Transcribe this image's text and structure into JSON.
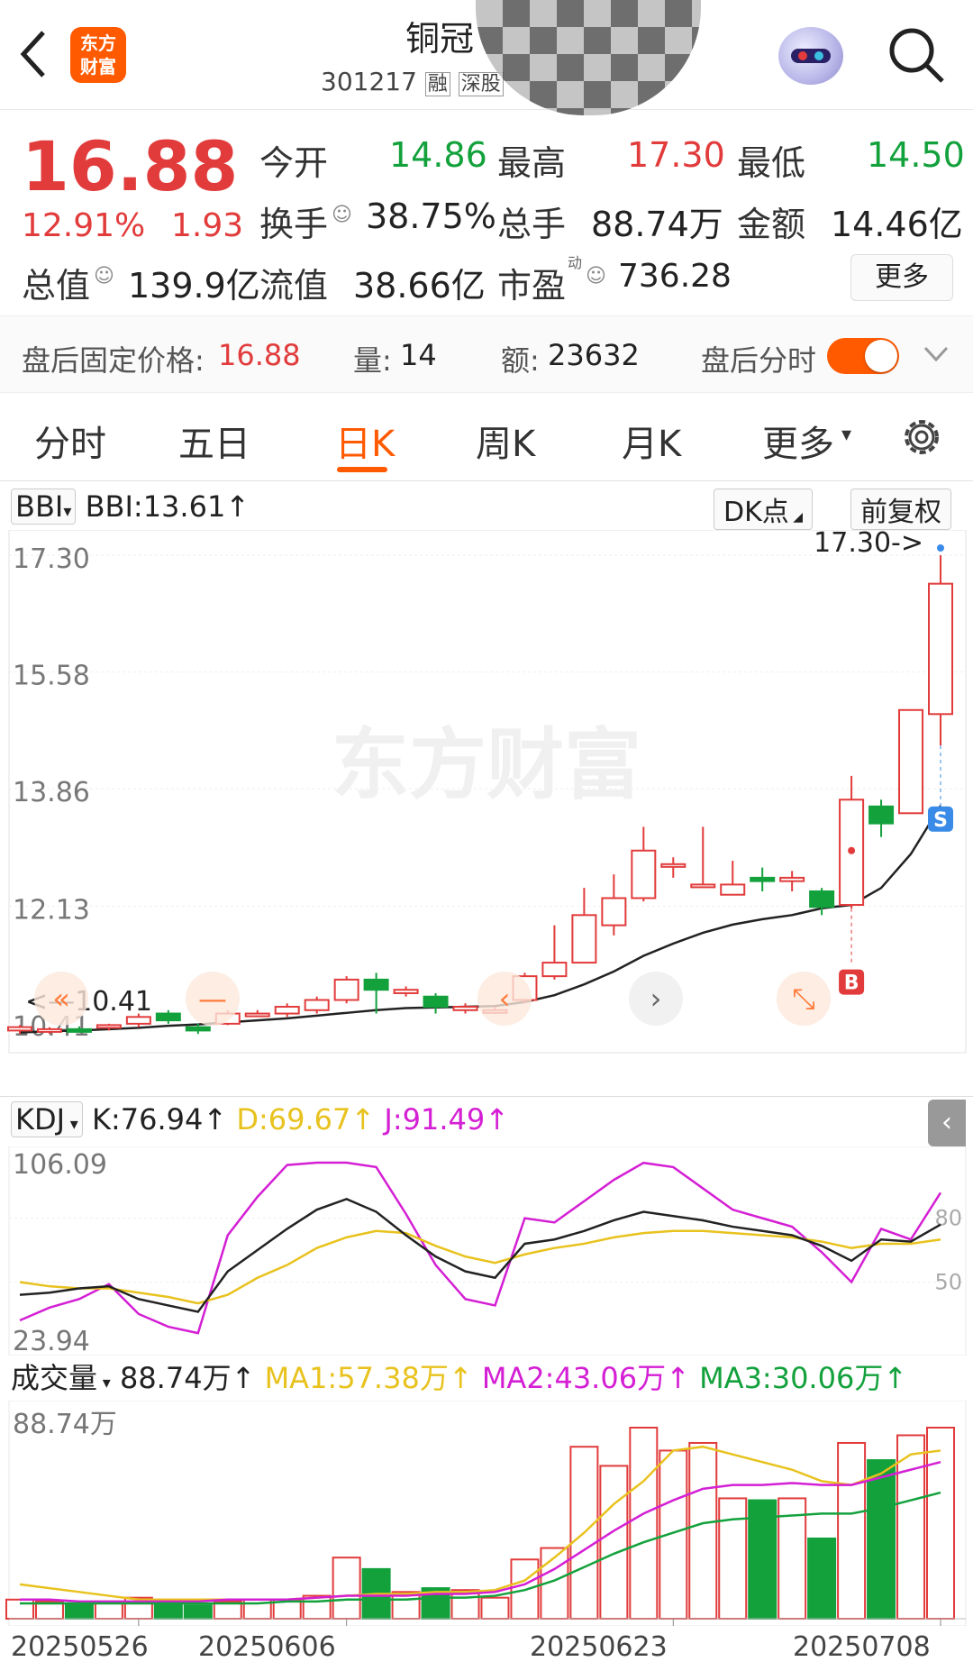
{
  "header": {
    "stock_name": "铜冠",
    "stock_code": "301217",
    "tag_margin": "融",
    "tag_market": "深股",
    "logo_line1": "东方",
    "logo_line2": "财富"
  },
  "quote": {
    "price": "16.88",
    "change_pct": "12.91%",
    "change_amt": "1.93",
    "open_label": "今开",
    "open": "14.86",
    "high_label": "最高",
    "high": "17.30",
    "low_label": "最低",
    "low": "14.50",
    "turnover_label": "换手",
    "turnover": "38.75%",
    "volume_label": "总手",
    "volume": "88.74万",
    "amount_label": "金额",
    "amount": "14.46亿",
    "mktcap_label": "总值",
    "mktcap": "139.9亿",
    "float_label": "流值",
    "float_cap": "38.66亿",
    "pe_label": "市盈",
    "pe_sup": "动",
    "pe": "736.28",
    "more_label": "更多"
  },
  "after_hours": {
    "price_label": "盘后固定价格:",
    "price": "16.88",
    "vol_label": "量:",
    "vol": "14",
    "amt_label": "额:",
    "amt": "23632",
    "toggle_label": "盘后分时",
    "toggle_on": true
  },
  "tabs": [
    "分时",
    "五日",
    "日K",
    "周K",
    "月K",
    "更多"
  ],
  "active_tab": "日K",
  "kline": {
    "indicator": "BBI",
    "bbi_text": "BBI:13.61",
    "dk_label": "DK点",
    "adj_label": "前复权",
    "y_ticks": [
      "17.30",
      "15.58",
      "13.86",
      "12.13"
    ],
    "low_tick": "10.41",
    "high_note": "17.30->",
    "low_note": "<—10.41",
    "watermark": "东方财富",
    "buy_marker": "B",
    "sell_marker": "S"
  },
  "kdj": {
    "label": "KDJ",
    "k": "K:76.94",
    "d": "D:69.67",
    "j": "J:91.49",
    "y_top": "106.09",
    "y_bottom": "23.94",
    "level80": "80",
    "level50": "50"
  },
  "volume_panel": {
    "label": "成交量",
    "vol": "88.74万",
    "ma1": "MA1:57.38万",
    "ma2": "MA2:43.06万",
    "ma3": "MA3:30.06万",
    "y_top": "88.74万"
  },
  "x_dates": [
    "20250526",
    "20250606",
    "20250623",
    "20250708"
  ],
  "colors": {
    "up": "#e23b3b",
    "down": "#13a13c",
    "accent": "#ff5a00",
    "bbi": "#222222",
    "k": "#222222",
    "d": "#e8c21e",
    "j": "#d41fd4",
    "ma1": "#e8c21e",
    "ma2": "#d41fd4",
    "ma3": "#13a13c"
  },
  "chart_data": {
    "type": "candlestick",
    "ylim": [
      10.41,
      17.3
    ],
    "candles": [
      {
        "o": 10.3,
        "c": 10.35,
        "h": 10.38,
        "l": 10.25
      },
      {
        "o": 10.28,
        "c": 10.32,
        "h": 10.35,
        "l": 10.25
      },
      {
        "o": 10.32,
        "c": 10.3,
        "h": 10.36,
        "l": 10.28
      },
      {
        "o": 10.35,
        "c": 10.38,
        "h": 10.4,
        "l": 10.3
      },
      {
        "o": 10.4,
        "c": 10.5,
        "h": 10.55,
        "l": 10.35
      },
      {
        "o": 10.55,
        "c": 10.45,
        "h": 10.6,
        "l": 10.4
      },
      {
        "o": 10.35,
        "c": 10.3,
        "h": 10.4,
        "l": 10.25
      },
      {
        "o": 10.4,
        "c": 10.55,
        "h": 10.6,
        "l": 10.38
      },
      {
        "o": 10.55,
        "c": 10.55,
        "h": 10.6,
        "l": 10.5
      },
      {
        "o": 10.55,
        "c": 10.65,
        "h": 10.7,
        "l": 10.5
      },
      {
        "o": 10.6,
        "c": 10.75,
        "h": 10.8,
        "l": 10.55
      },
      {
        "o": 10.75,
        "c": 11.05,
        "h": 11.1,
        "l": 10.7
      },
      {
        "o": 11.05,
        "c": 10.9,
        "h": 11.15,
        "l": 10.55
      },
      {
        "o": 10.85,
        "c": 10.9,
        "h": 10.95,
        "l": 10.8
      },
      {
        "o": 10.8,
        "c": 10.65,
        "h": 10.85,
        "l": 10.55
      },
      {
        "o": 10.6,
        "c": 10.65,
        "h": 10.7,
        "l": 10.55
      },
      {
        "o": 10.6,
        "c": 10.6,
        "h": 10.65,
        "l": 10.55
      },
      {
        "o": 10.75,
        "c": 11.1,
        "h": 11.15,
        "l": 10.7
      },
      {
        "o": 11.1,
        "c": 11.3,
        "h": 11.85,
        "l": 11.05
      },
      {
        "o": 11.3,
        "c": 12.0,
        "h": 12.4,
        "l": 11.3
      },
      {
        "o": 11.85,
        "c": 12.25,
        "h": 12.6,
        "l": 11.7
      },
      {
        "o": 12.25,
        "c": 12.95,
        "h": 13.3,
        "l": 12.2
      },
      {
        "o": 12.75,
        "c": 12.75,
        "h": 12.85,
        "l": 12.55
      },
      {
        "o": 12.45,
        "c": 12.45,
        "h": 13.3,
        "l": 12.4
      },
      {
        "o": 12.3,
        "c": 12.45,
        "h": 12.8,
        "l": 12.3
      },
      {
        "o": 12.55,
        "c": 12.5,
        "h": 12.7,
        "l": 12.35
      },
      {
        "o": 12.5,
        "c": 12.55,
        "h": 12.65,
        "l": 12.35
      },
      {
        "o": 12.35,
        "c": 12.12,
        "h": 12.4,
        "l": 12.0
      },
      {
        "o": 12.15,
        "c": 13.7,
        "h": 14.05,
        "l": 12.1
      },
      {
        "o": 13.6,
        "c": 13.35,
        "h": 13.7,
        "l": 13.15
      },
      {
        "o": 13.5,
        "c": 15.02,
        "h": 15.02,
        "l": 13.5
      },
      {
        "o": 14.96,
        "c": 16.88,
        "h": 17.3,
        "l": 14.5
      }
    ],
    "bbi": [
      10.27,
      10.29,
      10.3,
      10.32,
      10.34,
      10.37,
      10.39,
      10.42,
      10.45,
      10.48,
      10.52,
      10.56,
      10.6,
      10.63,
      10.64,
      10.65,
      10.66,
      10.72,
      10.82,
      10.98,
      11.17,
      11.4,
      11.58,
      11.74,
      11.86,
      11.94,
      12.0,
      12.1,
      12.15,
      12.4,
      12.9,
      13.61
    ],
    "volume": [
      0.1,
      0.09,
      0.08,
      0.09,
      0.11,
      0.08,
      0.07,
      0.09,
      0.1,
      0.1,
      0.12,
      0.32,
      0.26,
      0.14,
      0.16,
      0.15,
      0.11,
      0.31,
      0.37,
      0.9,
      0.8,
      1.0,
      0.88,
      0.92,
      0.63,
      0.62,
      0.63,
      0.42,
      0.92,
      0.83,
      0.96,
      1.0
    ],
    "ma1": [
      0.18,
      0.16,
      0.14,
      0.12,
      0.1,
      0.1,
      0.1,
      0.1,
      0.1,
      0.1,
      0.11,
      0.12,
      0.13,
      0.13,
      0.14,
      0.14,
      0.15,
      0.2,
      0.32,
      0.45,
      0.6,
      0.72,
      0.88,
      0.9,
      0.86,
      0.82,
      0.78,
      0.72,
      0.7,
      0.76,
      0.86,
      0.88
    ],
    "ma2": [
      0.1,
      0.1,
      0.09,
      0.09,
      0.09,
      0.09,
      0.09,
      0.1,
      0.1,
      0.1,
      0.11,
      0.12,
      0.12,
      0.12,
      0.13,
      0.13,
      0.14,
      0.18,
      0.26,
      0.36,
      0.46,
      0.55,
      0.62,
      0.68,
      0.7,
      0.7,
      0.71,
      0.7,
      0.7,
      0.74,
      0.78,
      0.82
    ],
    "ma3": [
      0.08,
      0.08,
      0.08,
      0.08,
      0.08,
      0.08,
      0.08,
      0.08,
      0.08,
      0.09,
      0.09,
      0.1,
      0.1,
      0.1,
      0.11,
      0.11,
      0.12,
      0.15,
      0.2,
      0.27,
      0.34,
      0.4,
      0.45,
      0.5,
      0.52,
      0.53,
      0.54,
      0.55,
      0.55,
      0.58,
      0.62,
      0.66
    ],
    "kdj_k": [
      44,
      45,
      47,
      48,
      42,
      39,
      36,
      55,
      65,
      75,
      84,
      89,
      83,
      72,
      62,
      55,
      52,
      68,
      70,
      74,
      79,
      83,
      81,
      79,
      76,
      74,
      72,
      67,
      60,
      70,
      69,
      77
    ],
    "kdj_d": [
      50,
      48,
      47,
      47,
      45,
      43,
      40,
      44,
      52,
      58,
      66,
      71,
      74,
      73,
      67,
      62,
      59,
      63,
      66,
      68,
      71,
      73,
      74,
      74,
      73,
      72,
      71,
      69,
      66,
      68,
      68,
      70
    ],
    "kdj_j": [
      32,
      38,
      42,
      49,
      35,
      29,
      26,
      72,
      90,
      105,
      110,
      118,
      104,
      82,
      58,
      42,
      39,
      80,
      78,
      88,
      98,
      106,
      104,
      94,
      84,
      80,
      76,
      64,
      50,
      75,
      70,
      92
    ]
  }
}
